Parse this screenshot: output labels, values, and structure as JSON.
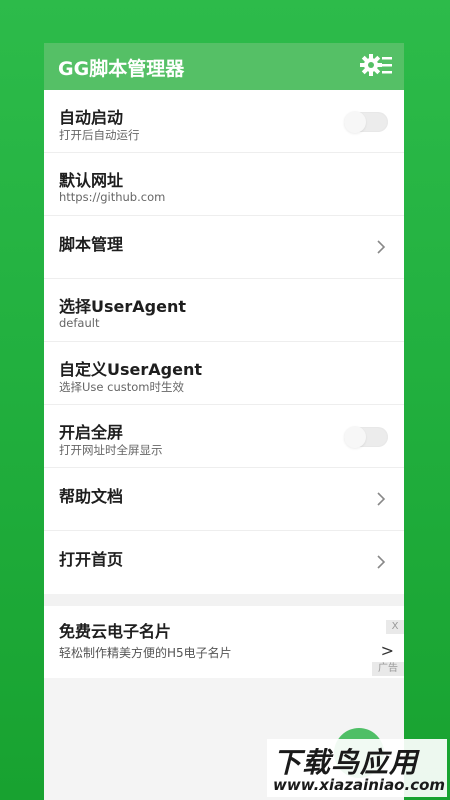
{
  "header": {
    "title": "GG脚本管理器",
    "settings_icon": "gear-menu-icon"
  },
  "settings": [
    {
      "label": "自动启动",
      "sub": "打开后自动运行",
      "control": "toggle",
      "checked": false
    },
    {
      "label": "默认网址",
      "sub": "https://github.com",
      "control": "none"
    },
    {
      "label": "脚本管理",
      "sub": "",
      "control": "chevron"
    },
    {
      "label": "选择UserAgent",
      "sub": "default",
      "control": "none"
    },
    {
      "label": "自定义UserAgent",
      "sub": "选择Use custom时生效",
      "control": "none"
    },
    {
      "label": "开启全屏",
      "sub": "打开网址时全屏显示",
      "control": "toggle",
      "checked": false
    },
    {
      "label": "帮助文档",
      "sub": "",
      "control": "chevron"
    },
    {
      "label": "打开首页",
      "sub": "",
      "control": "chevron"
    }
  ],
  "ad": {
    "title": "免费云电子名片",
    "subtitle": "轻松制作精美方便的H5电子名片",
    "close": "X",
    "arrow": ">",
    "tag": "广告"
  },
  "watermark": {
    "main": "下载鸟应用",
    "url": "www.xiazainiao.com"
  },
  "colors": {
    "header": "#55c066",
    "background": "#22b03f"
  }
}
